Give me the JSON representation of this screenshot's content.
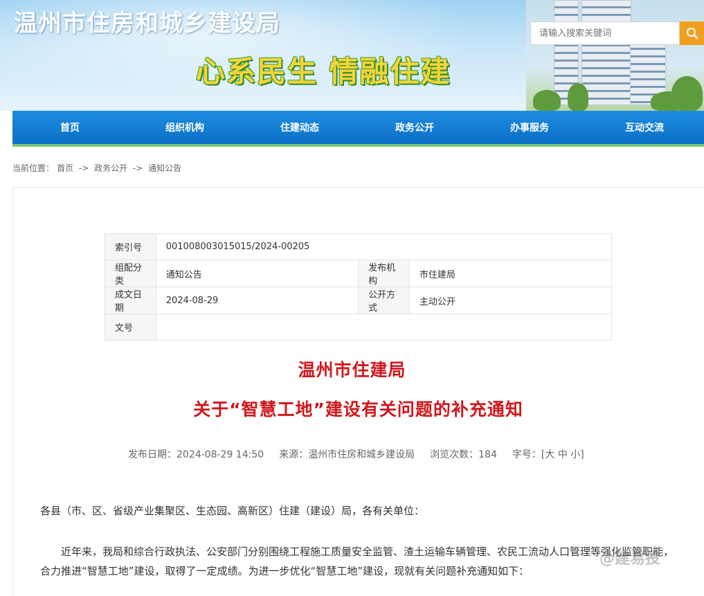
{
  "header": {
    "site_title": "温州市住房和城乡建设局",
    "slogan": "心系民生 情融住建",
    "search_placeholder": "请输入搜索关键词"
  },
  "nav": {
    "items": [
      "首页",
      "组织机构",
      "住建动态",
      "政务公开",
      "办事服务",
      "互动交流"
    ]
  },
  "breadcrumb": {
    "prefix": "当前位置：",
    "items": [
      "首页",
      "政务公开",
      "通知公告"
    ],
    "separator": "->"
  },
  "info_table": {
    "index_label": "索引号",
    "index_value": "001008003015015/2024-00205",
    "category_label": "组配分类",
    "category_value": "通知公告",
    "issuer_label": "发布机构",
    "issuer_value": "市住建局",
    "date_label": "成文日期",
    "date_value": "2024-08-29",
    "open_label": "公开方式",
    "open_value": "主动公开",
    "docno_label": "文号",
    "docno_value": ""
  },
  "article": {
    "title_line1": "温州市住建局",
    "title_line2": "关于“智慧工地”建设有关问题的补充通知",
    "publish_label": "发布日期：",
    "publish_value": "2024-08-29 14:50",
    "source_label": "来源：",
    "source_value": "温州市住房和城乡建设局",
    "views_label": "浏览次数：",
    "views_value": "184",
    "font_label": "字号：",
    "font_open": "[",
    "font_large": "大",
    "font_medium": "中",
    "font_small": "小",
    "font_close": "]",
    "salutation": "各县（市、区、省级产业集聚区、生态园、高新区）住建（建设）局，各有关单位：",
    "paragraph1": "近年来，我局和综合行政执法、公安部门分别围绕工程施工质量安全监管、渣土运输车辆管理、农民工流动人口管理等强化监管职能，合力推进“智慧工地”建设，取得了一定成绩。为进一步优化“智慧工地”建设，现就有关问题补充通知如下："
  },
  "watermark": "@建易投",
  "colors": {
    "nav_blue": "#0b6fc6",
    "nav_underline": "#7cc47a",
    "search_button": "#f0a020",
    "title_red": "#d0171c",
    "slogan_yellow": "#f5d43a"
  }
}
